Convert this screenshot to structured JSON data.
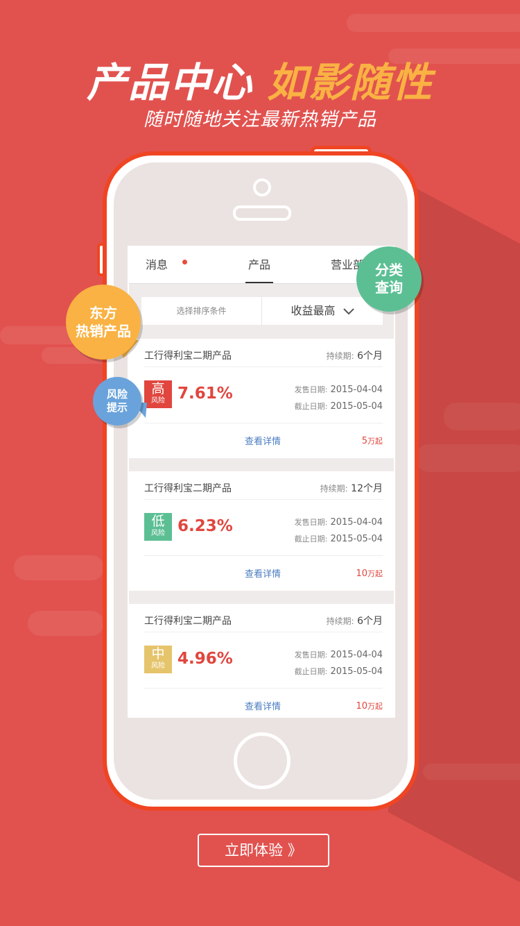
{
  "header": {
    "title_main": "产品中心",
    "title_accent": "如影随性",
    "subtitle": "随时随地关注最新热销产品"
  },
  "app": {
    "tabs": [
      {
        "label": "消息",
        "has_dot": true
      },
      {
        "label": "产品",
        "active": true
      },
      {
        "label": "营业部"
      }
    ],
    "sort": {
      "placeholder": "选择排序条件",
      "selected": "收益最高"
    },
    "duration_label": "持续期:",
    "sale_label": "发售日期:",
    "end_label": "截止日期:",
    "detail_link": "查看详情",
    "risk_suffix": "风险",
    "products": [
      {
        "name": "工行得利宝二期产品",
        "duration": "6个月",
        "risk": "高",
        "risk_color": "#e0463e",
        "rate": "7.61%",
        "sale_date": "2015-04-04",
        "end_date": "2015-05-04",
        "min_amount": "5",
        "min_unit": "万起"
      },
      {
        "name": "工行得利宝二期产品",
        "duration": "12个月",
        "risk": "低",
        "risk_color": "#5cbf94",
        "rate": "6.23%",
        "sale_date": "2015-04-04",
        "end_date": "2015-05-04",
        "min_amount": "10",
        "min_unit": "万起"
      },
      {
        "name": "工行得利宝二期产品",
        "duration": "6个月",
        "risk": "中",
        "risk_color": "#e5c46c",
        "rate": "4.96%",
        "sale_date": "2015-04-04",
        "end_date": "2015-05-04",
        "min_amount": "10",
        "min_unit": "万起"
      }
    ]
  },
  "bubbles": {
    "hot": {
      "line1": "东方",
      "line2": "热销产品",
      "color": "#f9b243"
    },
    "risk": {
      "line1": "风险",
      "line2": "提示",
      "color": "#6aa3db"
    },
    "category": {
      "line1": "分类",
      "line2": "查询",
      "color": "#5cbf94"
    }
  },
  "cta": {
    "label": "立即体验 》"
  },
  "colors": {
    "background": "#e1524f",
    "phone_border": "#ef4523",
    "rate": "#e0463e",
    "link": "#4a7cc0"
  }
}
